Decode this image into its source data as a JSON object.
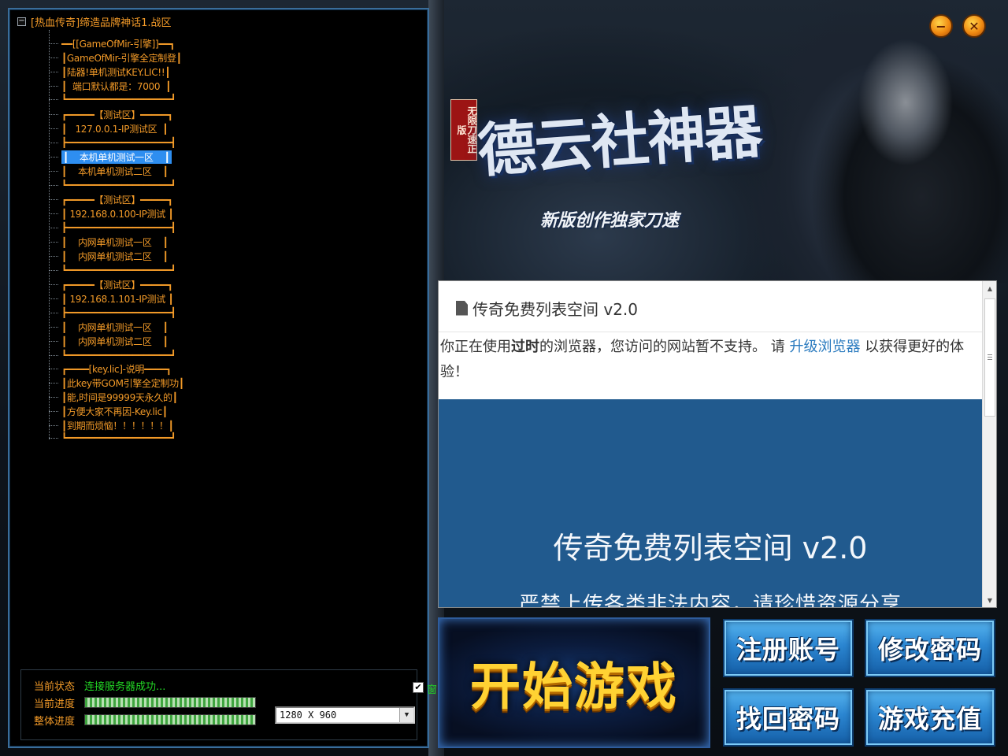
{
  "tree": {
    "root_label": "[热血传奇]缔造品牌神话1.战区",
    "collapse_symbol": "−",
    "items": [
      "━━[[GameOfMir-引擎]]━━┓",
      "┃GameOfMir-引擎全定制登┃",
      "┃陆器!单机测试KEY.LIC!!┃",
      "┃  端口默认都是：7000  ┃",
      "┗━━━━━━━━━━━━━━━━━━━┛",
      "┏━━━━━【测试区】━━━━━┓",
      "┃   127.0.0.1-IP测试区  ┃",
      "┣━━━━━━━━━━━━━━━━━━━┫",
      "┃    本机单机测试一区    ┃",
      "┃    本机单机测试二区    ┃",
      "┗━━━━━━━━━━━━━━━━━━━┛",
      "┏━━━━━【测试区】━━━━━┓",
      "┃ 192.168.0.100-IP测试 ┃",
      "┣━━━━━━━━━━━━━━━━━━━┫",
      "┃    内网单机测试一区    ┃",
      "┃    内网单机测试二区    ┃",
      "┗━━━━━━━━━━━━━━━━━━━┛",
      "┏━━━━━【测试区】━━━━━┓",
      "┃ 192.168.1.101-IP测试 ┃",
      "┣━━━━━━━━━━━━━━━━━━━┫",
      "┃    内网单机测试一区    ┃",
      "┃    内网单机测试二区    ┃",
      "┗━━━━━━━━━━━━━━━━━━━┛",
      "┏━━━━[key.lic]-说明━━━━┓",
      "┃此key带GOM引擎全定制功┃",
      "┃能,时间是99999天永久的┃",
      "┃方便大家不再因-Key.lic┃",
      "┃到期而烦恼！！！！！！┃",
      "┗━━━━━━━━━━━━━━━━━━━┛"
    ],
    "selected_label": "本机单机测试一区"
  },
  "status": {
    "current_state_label": "当前状态",
    "current_state_value": "连接服务器成功...",
    "current_progress_label": "当前进度",
    "current_progress_value": 1.0,
    "overall_progress_label": "整体进度",
    "overall_progress_value": 1.0,
    "resolution": "1280 X 960",
    "window_checkbox_label": "窗",
    "window_checked": true
  },
  "window_buttons": {
    "minimize_symbol": "−",
    "close_symbol": "✕"
  },
  "logo": {
    "title": "德云社神器",
    "badge": "无限刀速正版",
    "subtitle": "新版创作独家刀速"
  },
  "browser": {
    "header_title": "传奇免费列表空间 v2.0",
    "warning_prefix": "你正在使用",
    "warning_bold": "过时",
    "warning_mid": "的浏览器，您访问的网站暂不支持。 请 ",
    "warning_link": "升级浏览器",
    "warning_suffix": " 以获得更好的体验！",
    "hero_title": "传奇免费列表空间 v2.0",
    "hero_subtitle": "严禁上传各类非法内容，请珍惜资源分享"
  },
  "buttons": {
    "start_game": "开始游戏",
    "register": "注册账号",
    "change_password": "修改密码",
    "recover_password": "找回密码",
    "recharge": "游戏充值"
  },
  "colors": {
    "tree_text": "#f29a28",
    "selection": "#2e8ef0",
    "status_ok": "#22d624",
    "hero_bg": "#215a8e",
    "start_text": "#ffd233",
    "action_button": "#2b86d1"
  }
}
